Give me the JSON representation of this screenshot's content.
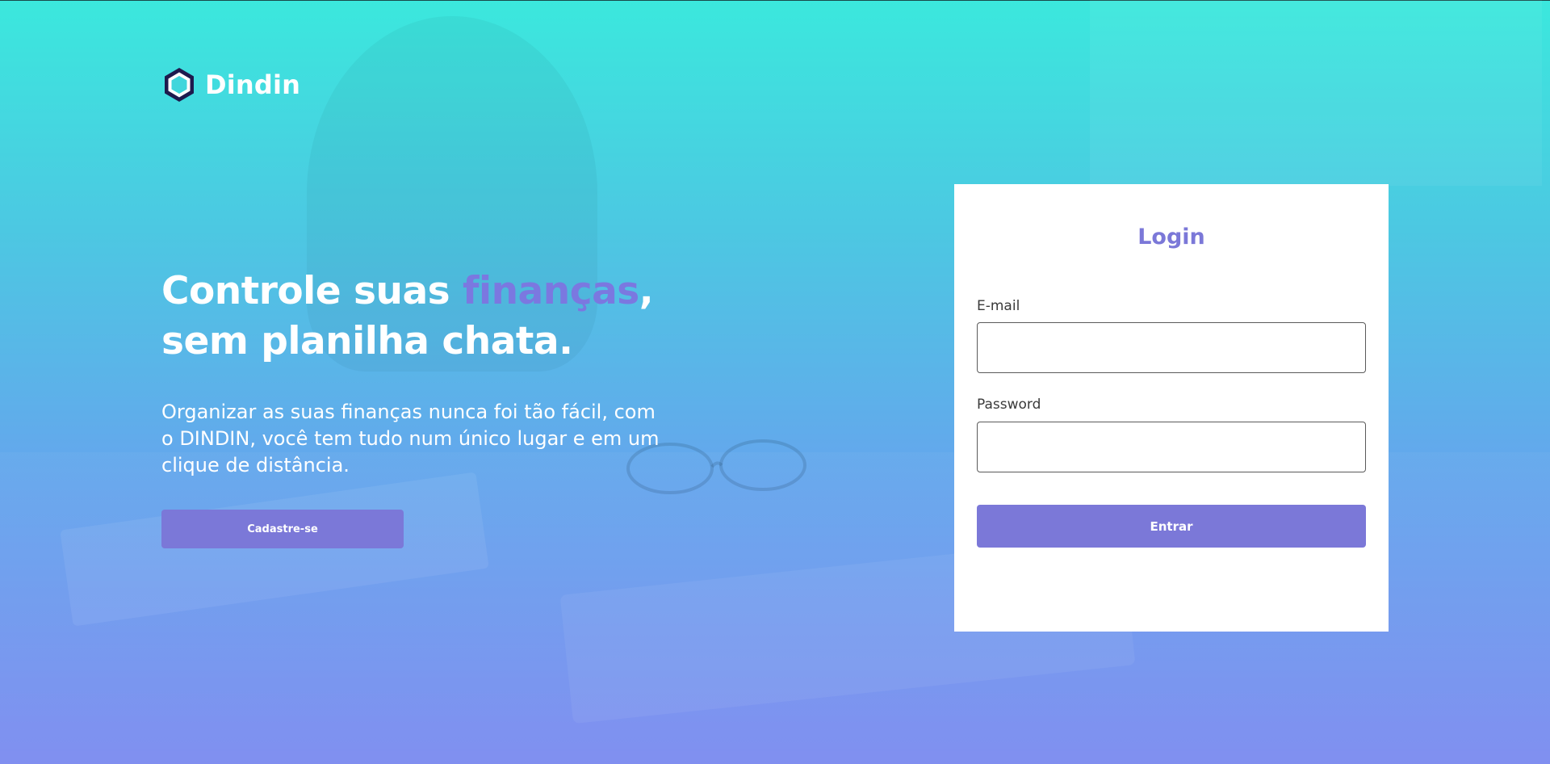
{
  "colors": {
    "accent": "#7b78d8",
    "gradient_top": "#3be8dd",
    "gradient_bottom": "#7686ef",
    "card_background": "#ffffff",
    "brand_icon_dark": "#1e1a4d"
  },
  "brand": {
    "name": "Dindin",
    "icon": "hexagon-logo-icon"
  },
  "hero": {
    "title_part1": "Controle suas ",
    "title_accent": "finanças",
    "title_part2": ",",
    "title_line2": "sem planilha chata.",
    "description": "Organizar as suas finanças nunca foi tão fácil, com o DINDIN, você tem tudo num único lugar e em um clique de distância.",
    "cta_label": "Cadastre-se"
  },
  "login": {
    "title": "Login",
    "email": {
      "label": "E-mail",
      "value": "",
      "placeholder": ""
    },
    "password": {
      "label": "Password",
      "value": "",
      "placeholder": ""
    },
    "submit_label": "Entrar"
  }
}
